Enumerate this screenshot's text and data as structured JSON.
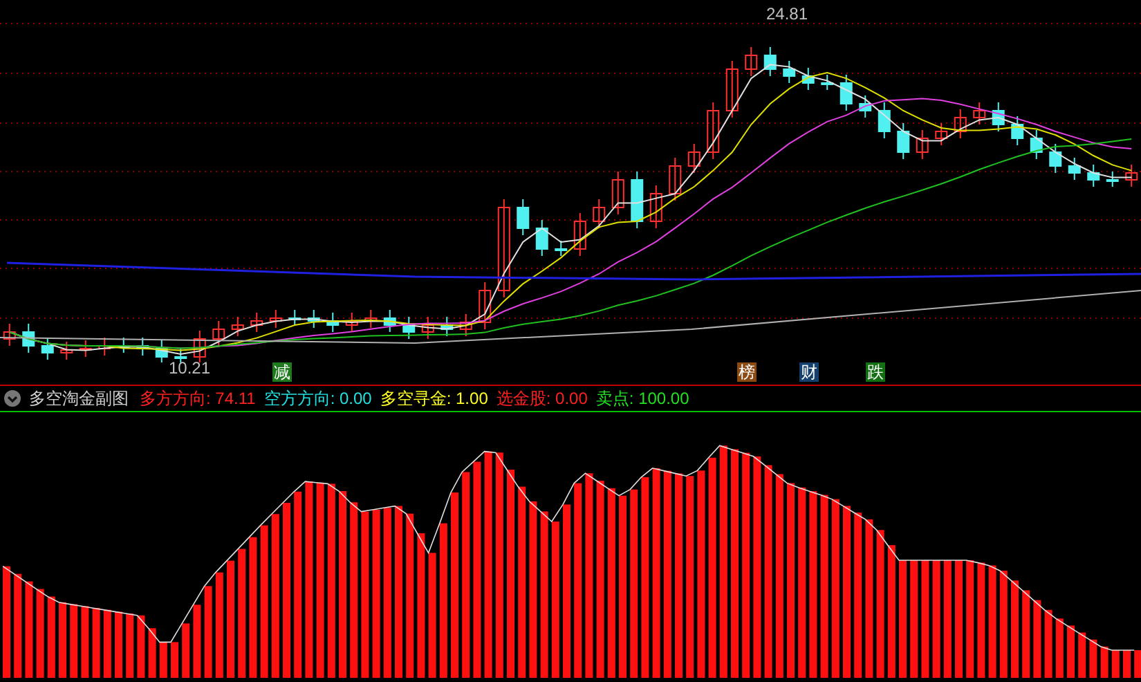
{
  "main_chart": {
    "high_label": "24.81",
    "low_label": "10.21",
    "markers": [
      {
        "text": "减",
        "color": "#1f7a1f"
      },
      {
        "text": "榜",
        "color": "#8a4a12"
      },
      {
        "text": "财",
        "color": "#14406e"
      },
      {
        "text": "跌",
        "color": "#127012"
      }
    ]
  },
  "indicator": {
    "title": "多空淘金副图",
    "values": [
      {
        "label": "多方方向:",
        "value": "74.11",
        "color": "#ff2020"
      },
      {
        "label": "空方方向:",
        "value": "0.00",
        "color": "#20e0e0"
      },
      {
        "label": "多空寻金:",
        "value": "1.00",
        "color": "#ffff20"
      },
      {
        "label": "选金股:",
        "value": "0.00",
        "color": "#ff2020"
      },
      {
        "label": "卖点:",
        "value": "100.00",
        "color": "#20e020"
      }
    ]
  }
}
